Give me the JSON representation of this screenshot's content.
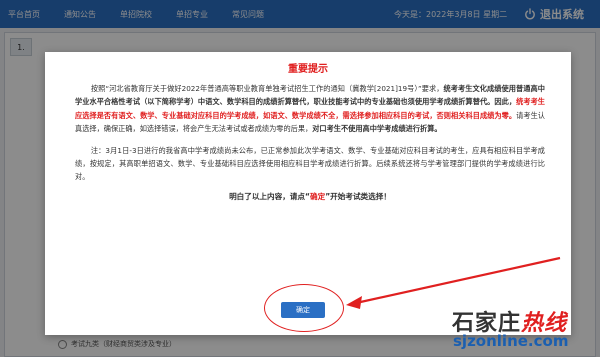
{
  "nav": {
    "items": [
      "平台首页",
      "通知公告",
      "单招院校",
      "单招专业",
      "常见问题"
    ],
    "date": "今天是：2022年3月8日 星期二",
    "logout_label": "退出系统"
  },
  "background": {
    "section_tab": "1.",
    "option_label": "考试九类（财经商贸类涉及专业）"
  },
  "modal": {
    "title": "重要提示",
    "p1": {
      "a": "按照“河北省教育厅关于做好2022年普通高等职业教育单独考试招生工作的通知（冀教学[2021]19号）”要求，",
      "b": "统考考生文化成绩使用普通高中学业水平合格性考试（以下简称学考）中语文、数学科目的成绩折算替代，职业技能考试中的专业基础也须使用学考成绩折算替代。因此，",
      "c": "统考考生应选择是否有语文、数学、专业基础对应科目的学考成绩，如语文、数学成绩不全，需选择参加相应科目的考试，否则相关科目成绩为零。",
      "d": "请考生认真选择，确保正确，如选择错误，将会产生无法考试或者成绩为零的后果，",
      "e": "对口考生不使用高中学考成绩进行折算。"
    },
    "p2": "注：3月1日-3日进行的我省高中学考成绩尚未公布，已正常参加此次学考语文、数学、专业基础对应科目考试的考生，应具有相应科目学考成绩，按规定，其高职单招语文、数学、专业基础科目应选择使用相应科目学考成绩进行折算。后续系统还将与学考管理部门提供的学考成绩进行比对。",
    "confirm": {
      "pre": "明白了以上内容，请点“",
      "key": "确定",
      "post": "”开始考试类选择！"
    },
    "ok_label": "确定"
  },
  "watermark": {
    "cn_dark": "石家庄",
    "cn_red": "热线",
    "url": "sjzonline.com"
  },
  "colors": {
    "brand_blue": "#2a6fc4",
    "alert_red": "#e02020"
  }
}
